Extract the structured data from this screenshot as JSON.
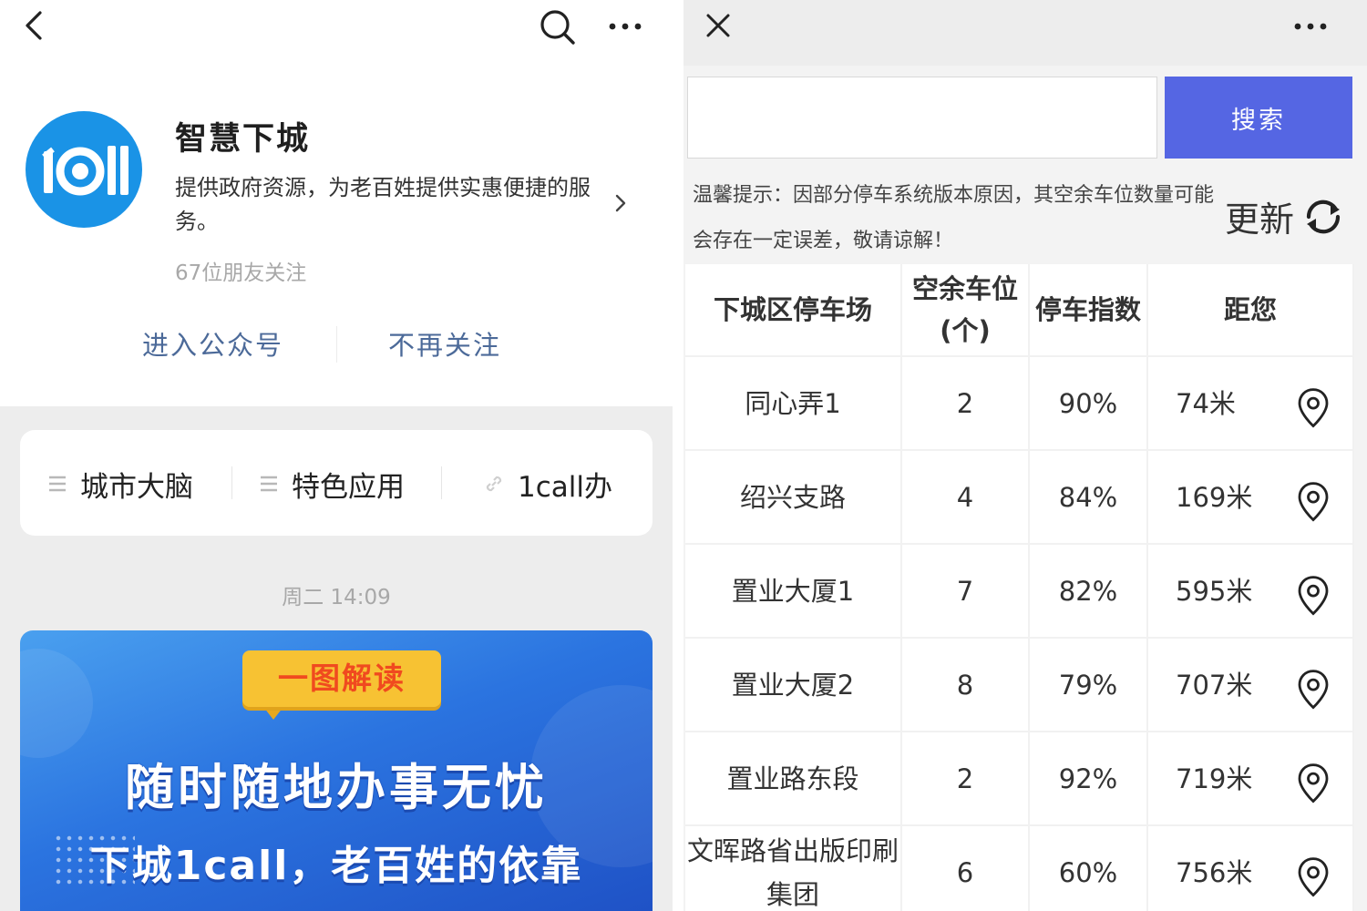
{
  "left": {
    "account": {
      "name": "智慧下城",
      "logo_text": "1call",
      "description": "提供政府资源，为老百姓提供实惠便捷的服务。",
      "followers": "67位朋友关注"
    },
    "actions": {
      "enter": "进入公众号",
      "unfollow": "不再关注"
    },
    "menu": [
      {
        "label": "城市大脑",
        "icon": "menu-lines-icon"
      },
      {
        "label": "特色应用",
        "icon": "menu-lines-icon"
      },
      {
        "label": "1call办",
        "icon": "link-icon"
      }
    ],
    "timestamp": "周二 14:09",
    "banner": {
      "tag": "一图解读",
      "title": "随时随地办事无忧",
      "subtitle": "下城1call，老百姓的依靠"
    }
  },
  "right": {
    "search": {
      "value": "",
      "button": "搜索"
    },
    "notice": "温馨提示：因部分停车系统版本原因，其空余车位数量可能会存在一定误差，敬请谅解！",
    "refresh_label": "更新",
    "table": {
      "headers": [
        "下城区停车场",
        "空余车位(个)",
        "停车指数",
        "距您"
      ],
      "rows": [
        {
          "name": "同心弄1",
          "free": "2",
          "index": "90%",
          "distance": "74米"
        },
        {
          "name": "绍兴支路",
          "free": "4",
          "index": "84%",
          "distance": "169米"
        },
        {
          "name": "置业大厦1",
          "free": "7",
          "index": "82%",
          "distance": "595米"
        },
        {
          "name": "置业大厦2",
          "free": "8",
          "index": "79%",
          "distance": "707米"
        },
        {
          "name": "置业路东段",
          "free": "2",
          "index": "92%",
          "distance": "719米"
        },
        {
          "name": "文晖路省出版印刷集团",
          "free": "6",
          "index": "60%",
          "distance": "756米"
        }
      ]
    }
  },
  "colors": {
    "logo_blue": "#1a93e6",
    "link_blue": "#4c6a99",
    "search_button": "#5566e3",
    "banner_blue": "#2b74e0",
    "tag_yellow": "#f7c233",
    "tag_text": "#f04a1f"
  }
}
